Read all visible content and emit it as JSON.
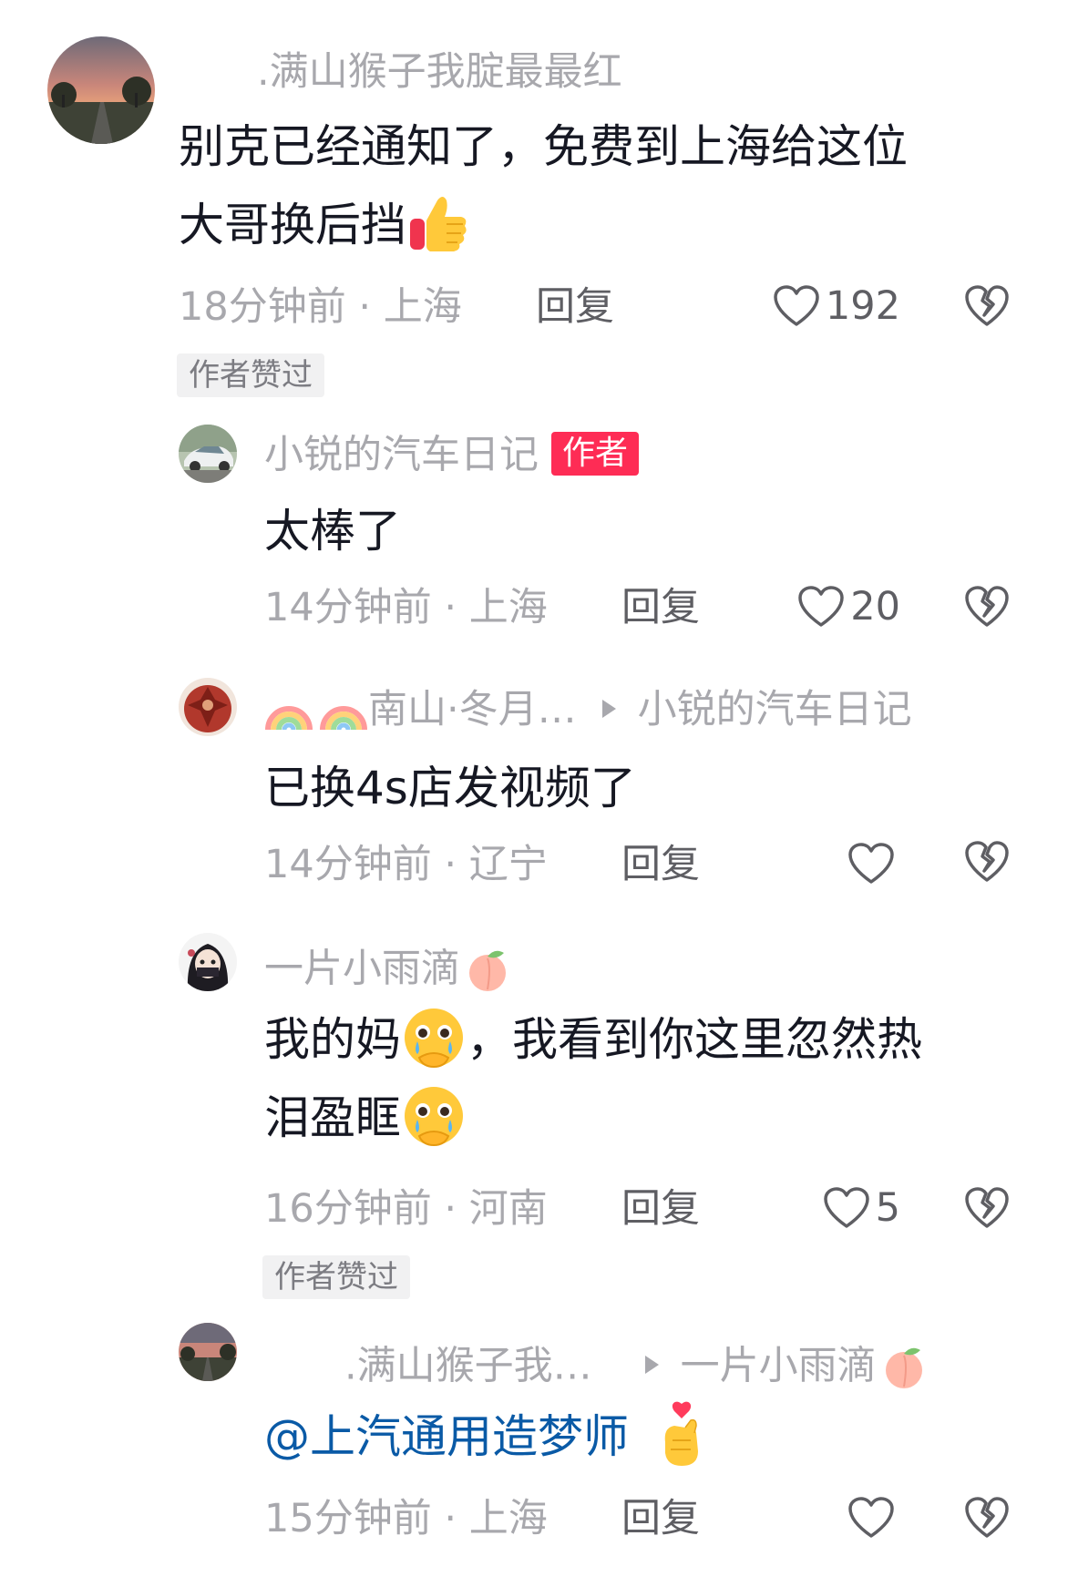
{
  "comments": [
    {
      "author": ".满山猴子我腚最最红",
      "text_line1": "别克已经通知了，免费到上海给这位",
      "text_line2": "大哥换后挡",
      "emoji": "thumbs-up",
      "time": "18分钟前",
      "location": "上海",
      "reply_label": "回复",
      "likes": "192",
      "liked_tag": "作者赞过"
    },
    {
      "author": "小锐的汽车日记",
      "badge": "作者",
      "text": "太棒了",
      "time": "14分钟前",
      "location": "上海",
      "reply_label": "回复",
      "likes": "20"
    },
    {
      "author": "南山·冬月…",
      "author_emojis": [
        "rainbow",
        "rainbow"
      ],
      "reply_to": "小锐的汽车日记",
      "text": "已换4s店发视频了",
      "time": "14分钟前",
      "location": "辽宁",
      "reply_label": "回复",
      "likes": ""
    },
    {
      "author": "一片小雨滴",
      "author_emoji": "peach",
      "text_part1": "我的妈",
      "text_part2": "，我看到你这里忽然热",
      "text_line2": "泪盈眶",
      "emoji": "holding-back-tears",
      "time": "16分钟前",
      "location": "河南",
      "reply_label": "回复",
      "likes": "5",
      "liked_tag": "作者赞过"
    },
    {
      "author": ".满山猴子我…",
      "reply_to": "一片小雨滴",
      "reply_to_emoji": "peach",
      "mention": "@上汽通用造梦师",
      "emoji": "hand-with-index-finger-and-thumb-crossed",
      "time": "15分钟前",
      "location": "上海",
      "reply_label": "回复",
      "likes": ""
    }
  ],
  "separator": "·",
  "colors": {
    "author_badge": "#fe2c55",
    "mention": "#0a5aa6",
    "muted": "#a8a8ad"
  }
}
